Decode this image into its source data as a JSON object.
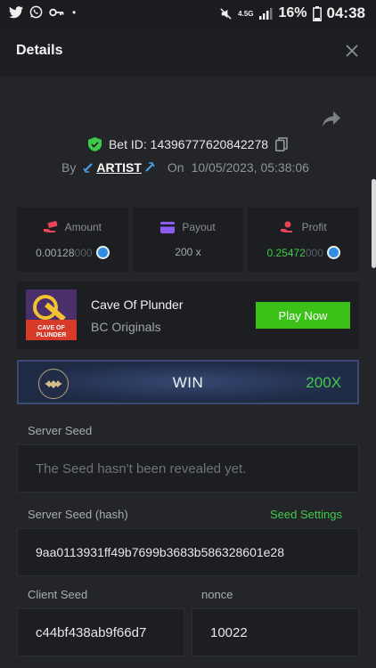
{
  "status_bar": {
    "network": "4.5G",
    "battery": "16%",
    "time": "04:38"
  },
  "header": {
    "title": "Details",
    "close_icon": "close-icon"
  },
  "bet": {
    "id_label": "Bet ID: 14396777620842278",
    "by_label": "By",
    "username": "ARTIST",
    "on_label": "On",
    "datetime": "10/05/2023, 05:38:06"
  },
  "stats": {
    "amount": {
      "label": "Amount",
      "value_main": "0.00128",
      "value_dim": "000"
    },
    "payout": {
      "label": "Payout",
      "value": "200 x"
    },
    "profit": {
      "label": "Profit",
      "value_main": "0.25472",
      "value_dim": "000"
    }
  },
  "game": {
    "thumb_text": "CAVE OF PLUNDER",
    "name": "Cave Of Plunder",
    "provider": "BC Originals",
    "play_label": "Play Now"
  },
  "result": {
    "label": "WIN",
    "multiplier": "200X"
  },
  "seeds": {
    "server_seed_label": "Server Seed",
    "server_seed_value": "The Seed hasn't been revealed yet.",
    "server_hash_label": "Server Seed (hash)",
    "seed_settings_label": "Seed Settings",
    "server_hash_value": "9aa0113931ff49b7699b3683b586328601e28",
    "client_seed_label": "Client Seed",
    "client_seed_value": "c44bf438ab9f66d7",
    "nonce_label": "nonce",
    "nonce_value": "10022"
  },
  "colors": {
    "accent_green": "#3fcb4a",
    "play_button": "#3bc117",
    "background": "#232529"
  }
}
